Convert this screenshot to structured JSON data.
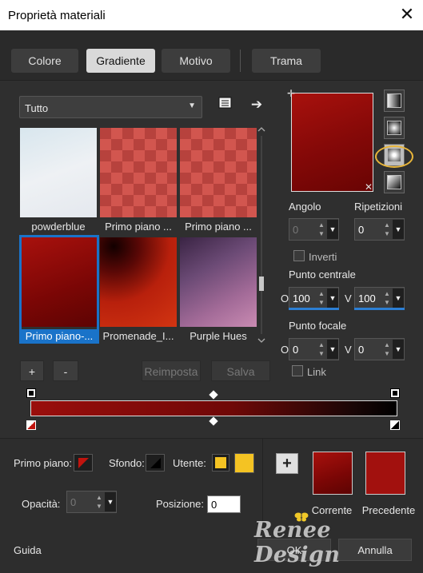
{
  "window": {
    "title": "Proprietà materiali",
    "close": "✕"
  },
  "tabs": [
    "Colore",
    "Gradiente",
    "Motivo",
    "Trama"
  ],
  "library": {
    "filter": "Tutto",
    "thumbnails": [
      {
        "caption": "powderblue"
      },
      {
        "caption": "Primo piano ..."
      },
      {
        "caption": "Primo piano ..."
      },
      {
        "caption": "Primo piano-..."
      },
      {
        "caption": "Promenade_I..."
      },
      {
        "caption": "Purple Hues"
      }
    ]
  },
  "buttons": {
    "add": "+",
    "remove": "-",
    "reset": "Reimposta",
    "save": "Salva"
  },
  "params": {
    "angle_label": "Angolo",
    "angle_value": "0",
    "repeat_label": "Ripetizioni",
    "repeat_value": "0",
    "invert_label": "Inverti",
    "center_label": "Punto centrale",
    "center_h_label": "O",
    "center_h": "100",
    "center_v_label": "V",
    "center_v": "100",
    "focal_label": "Punto focale",
    "focal_h_label": "O",
    "focal_h": "0",
    "focal_v_label": "V",
    "focal_v": "0",
    "link_label": "Link"
  },
  "bottom": {
    "foreground_label": "Primo piano:",
    "background_label": "Sfondo:",
    "user_label": "Utente:",
    "opacity_label": "Opacità:",
    "opacity_value": "0",
    "position_label": "Posizione:",
    "position_value": "0",
    "current_label": "Corrente",
    "previous_label": "Precedente",
    "add_swatch": "+"
  },
  "footer": {
    "help": "Guida",
    "ok": "OK",
    "cancel": "Annulla"
  },
  "watermark": "Renee Design",
  "colors": {
    "gradient_dark": "#6e0303",
    "gradient_light": "#a2110e",
    "user_yellow": "#f4c323",
    "selection_blue": "#1a73c9",
    "highlight_circle": "#e8b53a"
  }
}
